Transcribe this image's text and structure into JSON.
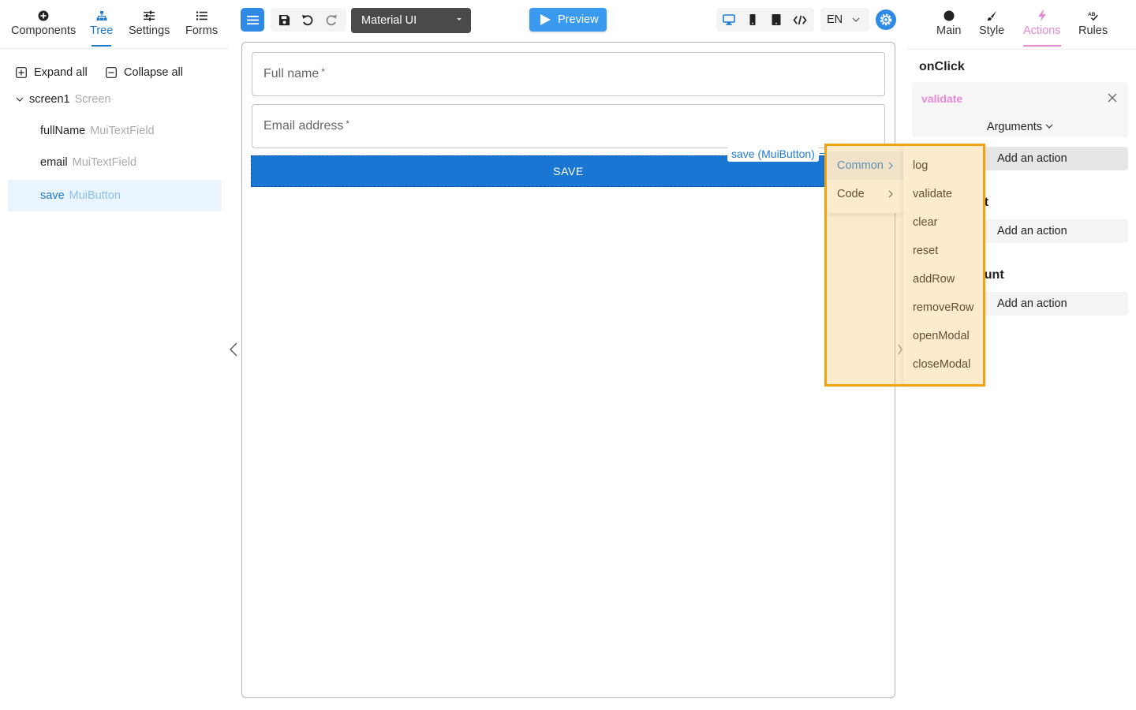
{
  "left_tabs": [
    {
      "label": "Components",
      "icon": "plus-circle-icon"
    },
    {
      "label": "Tree",
      "icon": "tree-icon"
    },
    {
      "label": "Settings",
      "icon": "sliders-icon"
    },
    {
      "label": "Forms",
      "icon": "list-icon"
    }
  ],
  "tree_actions": {
    "expand_all": "Expand all",
    "collapse_all": "Collapse all"
  },
  "tree": [
    {
      "name": "screen1",
      "type": "Screen"
    },
    {
      "name": "fullName",
      "type": "MuiTextField"
    },
    {
      "name": "email",
      "type": "MuiTextField"
    },
    {
      "name": "save",
      "type": "MuiButton"
    }
  ],
  "toolbar": {
    "theme": "Material UI",
    "preview_label": "Preview",
    "language": "EN"
  },
  "canvas": {
    "fullname_label": "Full name",
    "email_label": "Email address",
    "required_mark": "*",
    "save_button": "SAVE",
    "selection_label": "save (MuiButton)"
  },
  "right_tabs": [
    {
      "label": "Main",
      "icon": "circle-icon"
    },
    {
      "label": "Style",
      "icon": "brush-icon"
    },
    {
      "label": "Actions",
      "icon": "lightning-icon"
    },
    {
      "label": "Rules",
      "icon": "spellcheck-icon"
    }
  ],
  "actions_panel": {
    "onclick_title": "onClick",
    "existing_action": "validate",
    "arguments_label": "Arguments",
    "add_action_label": "Add an action",
    "partial_title_2": "nt",
    "partial_title_3": "ount"
  },
  "menu": {
    "categories": [
      "Common",
      "Code"
    ],
    "common_items": [
      "log",
      "validate",
      "clear",
      "reset",
      "addRow",
      "removeRow",
      "openModal",
      "closeModal"
    ]
  },
  "colors": {
    "primary": "#1976d2",
    "accent_blue": "#1f7bd1",
    "actions_pink": "#e68ad4",
    "highlight_orange": "#f2a20f"
  }
}
